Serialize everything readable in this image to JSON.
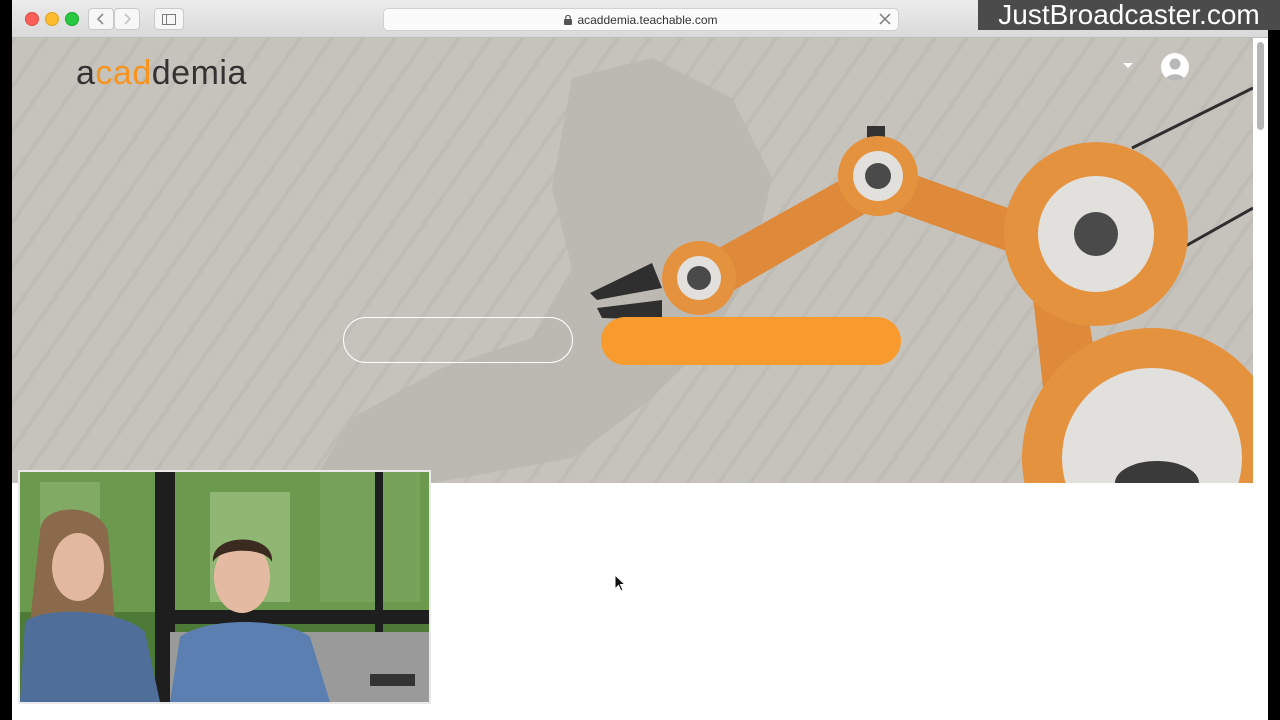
{
  "browser": {
    "url": "acaddemia.teachable.com"
  },
  "site": {
    "logo_text": {
      "part1": "a",
      "part2": "cad",
      "part3": "demia"
    },
    "accent_color": "#f89b2e"
  },
  "icons": {
    "back": "chevron-left-icon",
    "forward": "chevron-right-icon",
    "sidebar": "sidebar-icon",
    "lock": "lock-icon",
    "close": "close-icon",
    "user": "user-icon",
    "caret": "caret-down-icon"
  },
  "watermark": "JustBroadcaster.com"
}
